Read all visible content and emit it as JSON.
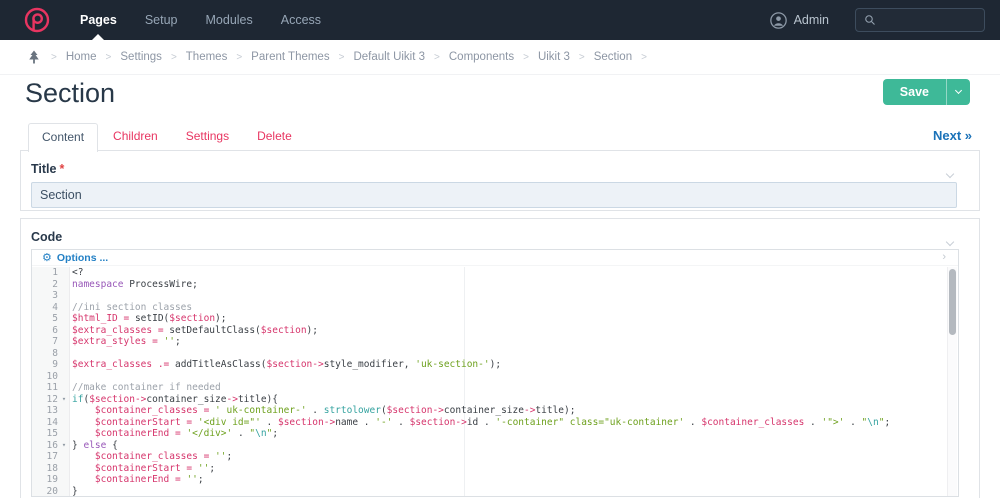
{
  "navbar": {
    "items": [
      {
        "label": "Pages",
        "active": true
      },
      {
        "label": "Setup",
        "active": false
      },
      {
        "label": "Modules",
        "active": false
      },
      {
        "label": "Access",
        "active": false
      }
    ],
    "user": "Admin",
    "search": {
      "placeholder": "",
      "value": ""
    }
  },
  "breadcrumb": {
    "separator": ">",
    "items": [
      "Home",
      "Settings",
      "Themes",
      "Parent Themes",
      "Default Uikit 3",
      "Components",
      "Uikit 3",
      "Section"
    ]
  },
  "page": {
    "title": "Section"
  },
  "actions": {
    "save_label": "Save"
  },
  "tabs": [
    {
      "label": "Content",
      "active": true
    },
    {
      "label": "Children",
      "active": false
    },
    {
      "label": "Settings",
      "active": false
    },
    {
      "label": "Delete",
      "active": false
    }
  ],
  "next_link": "Next »",
  "fields": {
    "title": {
      "label": "Title",
      "required_marker": "*",
      "value": "Section"
    },
    "code": {
      "label": "Code",
      "options_label": "Options ...",
      "options_chevron": "›"
    }
  },
  "colors": {
    "navbar_bg": "#1E2733",
    "brand_pink": "#E83561",
    "save_green": "#3EB998",
    "link_blue": "#1B72B8",
    "input_bg": "#EDF2F7"
  },
  "editor": {
    "fold_marker": "▾",
    "lines": [
      {
        "n": 1,
        "spans": [
          [
            "p",
            "<?"
          ]
        ]
      },
      {
        "n": 2,
        "spans": [
          [
            "k",
            "namespace"
          ],
          [
            "p",
            " ProcessWire;"
          ]
        ]
      },
      {
        "n": 3,
        "spans": []
      },
      {
        "n": 4,
        "spans": [
          [
            "c",
            "//ini section classes"
          ]
        ]
      },
      {
        "n": 5,
        "spans": [
          [
            "v",
            "$html_ID"
          ],
          [
            "p",
            " "
          ],
          [
            "o",
            "="
          ],
          [
            "p",
            " setID("
          ],
          [
            "v",
            "$section"
          ],
          [
            "p",
            ");"
          ]
        ]
      },
      {
        "n": 6,
        "spans": [
          [
            "v",
            "$extra_classes"
          ],
          [
            "p",
            " "
          ],
          [
            "o",
            "="
          ],
          [
            "p",
            " setDefaultClass("
          ],
          [
            "v",
            "$section"
          ],
          [
            "p",
            ");"
          ]
        ]
      },
      {
        "n": 7,
        "spans": [
          [
            "v",
            "$extra_styles"
          ],
          [
            "p",
            " "
          ],
          [
            "o",
            "="
          ],
          [
            "p",
            " "
          ],
          [
            "s",
            "''"
          ],
          [
            "p",
            ";"
          ]
        ]
      },
      {
        "n": 8,
        "spans": []
      },
      {
        "n": 9,
        "spans": [
          [
            "v",
            "$extra_classes"
          ],
          [
            "p",
            " "
          ],
          [
            "o",
            ".="
          ],
          [
            "p",
            " addTitleAsClass("
          ],
          [
            "v",
            "$section"
          ],
          [
            "o",
            "->"
          ],
          [
            "p",
            "style_modifier, "
          ],
          [
            "s",
            "'uk-section-'"
          ],
          [
            "p",
            ");"
          ]
        ]
      },
      {
        "n": 10,
        "spans": []
      },
      {
        "n": 11,
        "spans": [
          [
            "c",
            "//make container if needed"
          ]
        ]
      },
      {
        "n": 12,
        "fold": true,
        "spans": [
          [
            "t",
            "if"
          ],
          [
            "p",
            "("
          ],
          [
            "v",
            "$section"
          ],
          [
            "o",
            "->"
          ],
          [
            "p",
            "container_size"
          ],
          [
            "o",
            "->"
          ],
          [
            "p",
            "title){"
          ]
        ]
      },
      {
        "n": 13,
        "spans": [
          [
            "p",
            "    "
          ],
          [
            "v",
            "$container_classes"
          ],
          [
            "p",
            " "
          ],
          [
            "o",
            "="
          ],
          [
            "p",
            " "
          ],
          [
            "s",
            "' uk-container-'"
          ],
          [
            "p",
            " . "
          ],
          [
            "t",
            "strtolower"
          ],
          [
            "p",
            "("
          ],
          [
            "v",
            "$section"
          ],
          [
            "o",
            "->"
          ],
          [
            "p",
            "container_size"
          ],
          [
            "o",
            "->"
          ],
          [
            "p",
            "title);"
          ]
        ]
      },
      {
        "n": 14,
        "spans": [
          [
            "p",
            "    "
          ],
          [
            "v",
            "$containerStart"
          ],
          [
            "p",
            " "
          ],
          [
            "o",
            "="
          ],
          [
            "p",
            " "
          ],
          [
            "s",
            "'<div id=\"'"
          ],
          [
            "p",
            " . "
          ],
          [
            "v",
            "$section"
          ],
          [
            "o",
            "->"
          ],
          [
            "p",
            "name . "
          ],
          [
            "s",
            "'-'"
          ],
          [
            "p",
            " . "
          ],
          [
            "v",
            "$section"
          ],
          [
            "o",
            "->"
          ],
          [
            "p",
            "id . "
          ],
          [
            "s",
            "'-container\" class=\"uk-container'"
          ],
          [
            "p",
            " . "
          ],
          [
            "v",
            "$container_classes"
          ],
          [
            "p",
            " . "
          ],
          [
            "s",
            "'\">'"
          ],
          [
            "p",
            " . "
          ],
          [
            "s",
            "\""
          ],
          [
            "e",
            "\\n"
          ],
          [
            "s",
            "\""
          ],
          [
            "p",
            ";"
          ]
        ]
      },
      {
        "n": 15,
        "spans": [
          [
            "p",
            "    "
          ],
          [
            "v",
            "$containerEnd"
          ],
          [
            "p",
            " "
          ],
          [
            "o",
            "="
          ],
          [
            "p",
            " "
          ],
          [
            "s",
            "'</div>'"
          ],
          [
            "p",
            " . "
          ],
          [
            "s",
            "\""
          ],
          [
            "e",
            "\\n"
          ],
          [
            "s",
            "\""
          ],
          [
            "p",
            ";"
          ]
        ]
      },
      {
        "n": 16,
        "fold": true,
        "spans": [
          [
            "p",
            "} "
          ],
          [
            "k",
            "else"
          ],
          [
            "p",
            " {"
          ]
        ]
      },
      {
        "n": 17,
        "spans": [
          [
            "p",
            "    "
          ],
          [
            "v",
            "$container_classes"
          ],
          [
            "p",
            " "
          ],
          [
            "o",
            "="
          ],
          [
            "p",
            " "
          ],
          [
            "s",
            "''"
          ],
          [
            "p",
            ";"
          ]
        ]
      },
      {
        "n": 18,
        "spans": [
          [
            "p",
            "    "
          ],
          [
            "v",
            "$containerStart"
          ],
          [
            "p",
            " "
          ],
          [
            "o",
            "="
          ],
          [
            "p",
            " "
          ],
          [
            "s",
            "''"
          ],
          [
            "p",
            ";"
          ]
        ]
      },
      {
        "n": 19,
        "spans": [
          [
            "p",
            "    "
          ],
          [
            "v",
            "$containerEnd"
          ],
          [
            "p",
            " "
          ],
          [
            "o",
            "="
          ],
          [
            "p",
            " "
          ],
          [
            "s",
            "''"
          ],
          [
            "p",
            ";"
          ]
        ]
      },
      {
        "n": 20,
        "spans": [
          [
            "p",
            "}"
          ]
        ]
      }
    ]
  }
}
